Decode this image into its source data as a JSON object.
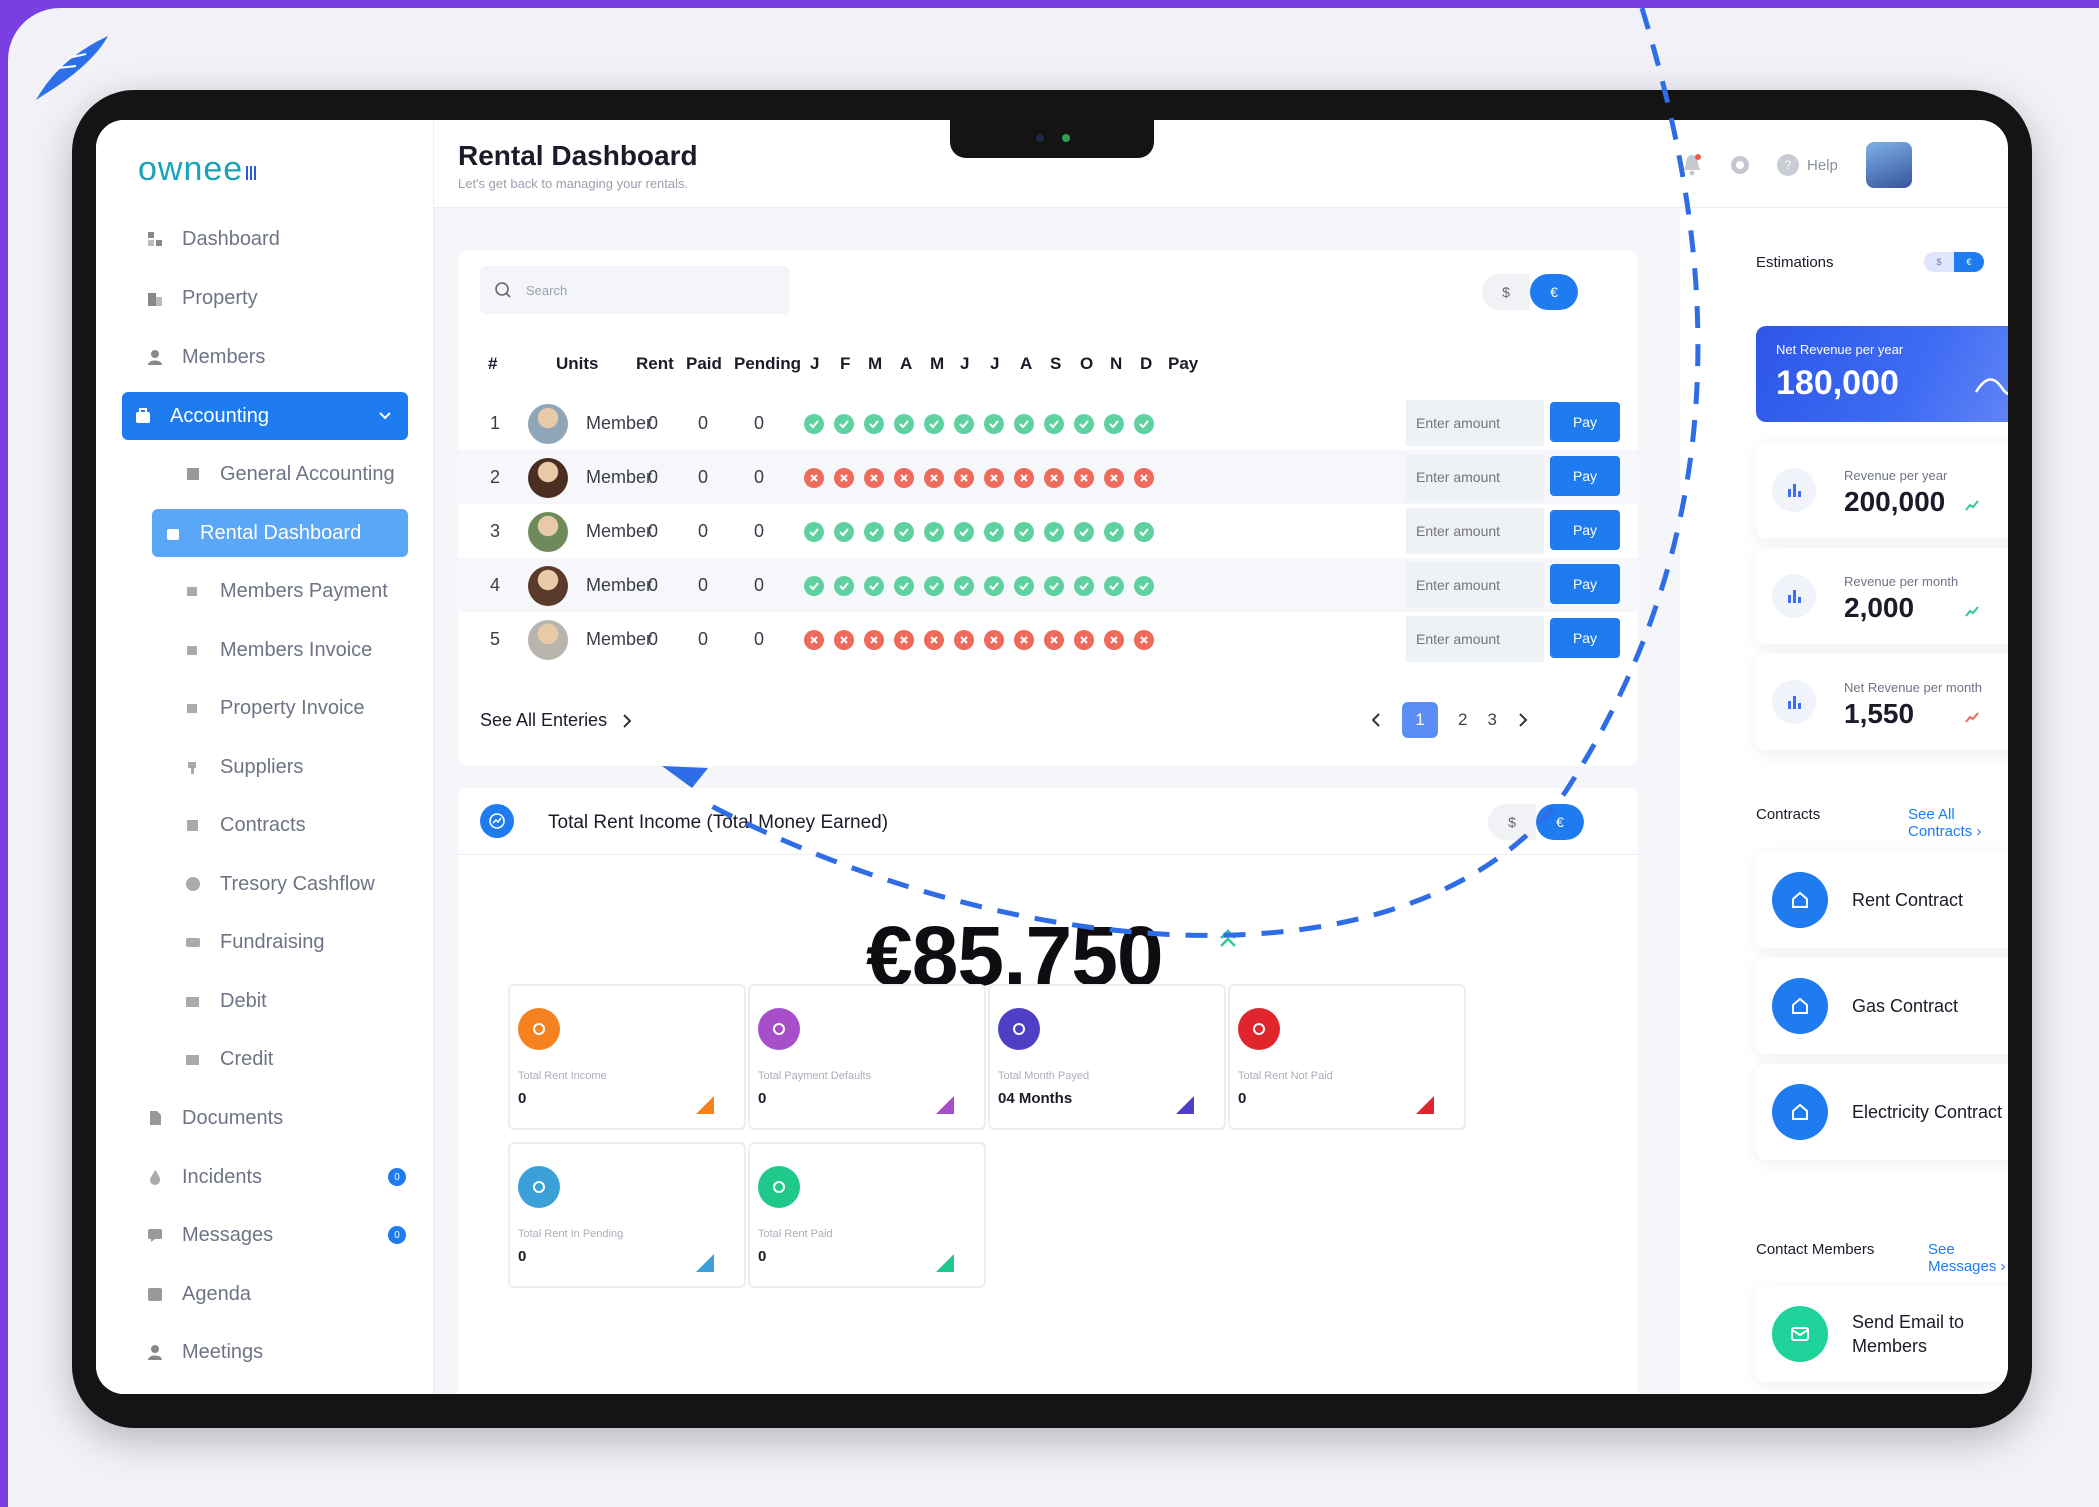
{
  "app": {
    "logo": "ownee"
  },
  "header": {
    "title": "Rental Dashboard",
    "subtitle": "Let's get back to managing your rentals.",
    "help": "Help"
  },
  "sidebar": {
    "items": [
      {
        "label": "Dashboard"
      },
      {
        "label": "Property"
      },
      {
        "label": "Members"
      },
      {
        "label": "Accounting"
      },
      {
        "label": "General Accounting"
      },
      {
        "label": "Rental Dashboard"
      },
      {
        "label": "Members Payment"
      },
      {
        "label": "Members Invoice"
      },
      {
        "label": "Property Invoice"
      },
      {
        "label": "Suppliers"
      },
      {
        "label": "Contracts"
      },
      {
        "label": "Tresory Cashflow"
      },
      {
        "label": "Fundraising"
      },
      {
        "label": "Debit"
      },
      {
        "label": "Credit"
      },
      {
        "label": "Documents"
      },
      {
        "label": "Incidents",
        "badge": "0"
      },
      {
        "label": "Messages",
        "badge": "0"
      },
      {
        "label": "Agenda"
      },
      {
        "label": "Meetings"
      }
    ]
  },
  "table": {
    "search_placeholder": "Search",
    "currency": {
      "usd": "$",
      "eur": "€"
    },
    "headers": [
      "#",
      "Units",
      "Rent",
      "Paid",
      "Pending",
      "J",
      "F",
      "M",
      "A",
      "M",
      "J",
      "J",
      "A",
      "S",
      "O",
      "N",
      "D",
      "Pay"
    ],
    "amount_placeholder": "Enter amount",
    "pay_label": "Pay",
    "rows": [
      {
        "num": "1",
        "unit": "Member",
        "rent": "0",
        "paid": "0",
        "pending": "0",
        "status": "paid"
      },
      {
        "num": "2",
        "unit": "Member",
        "rent": "0",
        "paid": "0",
        "pending": "0",
        "status": "unpaid"
      },
      {
        "num": "3",
        "unit": "Member",
        "rent": "0",
        "paid": "0",
        "pending": "0",
        "status": "paid"
      },
      {
        "num": "4",
        "unit": "Member",
        "rent": "0",
        "paid": "0",
        "pending": "0",
        "status": "paid"
      },
      {
        "num": "5",
        "unit": "Member",
        "rent": "0",
        "paid": "0",
        "pending": "0",
        "status": "unpaid"
      }
    ],
    "see_all": "See All Enteries",
    "pages": [
      "1",
      "2",
      "3"
    ]
  },
  "income": {
    "title": "Total Rent Income (Total Money Earned)",
    "amount": "€85,750",
    "stats": [
      {
        "label": "Total Rent Income",
        "value": "0",
        "color": "#f5821f"
      },
      {
        "label": "Total Payment Defaults",
        "value": "0",
        "color": "#a64fc9"
      },
      {
        "label": "Total Month Payed",
        "value": "04 Months",
        "color": "#4f3fc4"
      },
      {
        "label": "Total Rent Not Paid",
        "value": "0",
        "color": "#e0262c"
      },
      {
        "label": "Total Rent In Pending",
        "value": "0",
        "color": "#3b9fd8"
      },
      {
        "label": "Total Rent Paid",
        "value": "0",
        "color": "#1fc98b"
      }
    ]
  },
  "right_panel": {
    "estimations": "Estimations",
    "toggle": {
      "usd": "$",
      "eur": "€"
    },
    "net_year": {
      "label": "Net Revenue per year",
      "value": "180,000"
    },
    "cards": [
      {
        "label": "Revenue per year",
        "value": "200,000"
      },
      {
        "label": "Revenue per month",
        "value": "2,000"
      },
      {
        "label": "Net Revenue per month",
        "value": "1,550"
      }
    ],
    "contracts_title": "Contracts",
    "contracts_link": "See All Contracts",
    "contracts": [
      {
        "label": "Rent Contract"
      },
      {
        "label": "Gas Contract"
      },
      {
        "label": "Electricity Contract"
      }
    ],
    "contact_title": "Contact Members",
    "contact_link": "See Messages",
    "contact_action": "Send Email to Members"
  }
}
